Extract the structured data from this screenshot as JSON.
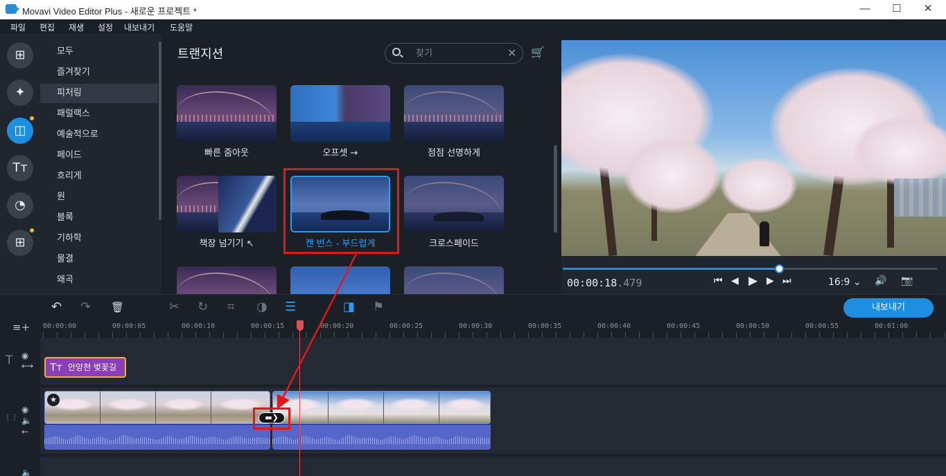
{
  "window": {
    "title": "Movavi Video Editor Plus - 새로운 프로젝트 *",
    "minimize": "—",
    "maximize": "☐",
    "close": "✕"
  },
  "menu": [
    "파일",
    "편집",
    "재생",
    "설정",
    "내보내기",
    "도움말"
  ],
  "icons": {
    "import": "⊞",
    "magic": "✦",
    "transitions": "◫",
    "titles": "Tт",
    "stickers": "◔",
    "more": "⊞"
  },
  "categories": [
    "모두",
    "즐겨찾기",
    "피처링",
    "패럴랙스",
    "예술적으로",
    "페이드",
    "흐리게",
    "원",
    "블록",
    "기하학",
    "물결",
    "왜곡"
  ],
  "active_category": "피처링",
  "panel": {
    "title": "트랜지션",
    "search_placeholder": "찾기",
    "clear": "✕",
    "cart": "🛒"
  },
  "tiles": [
    {
      "label": "빠른 줌아웃"
    },
    {
      "label": "오프셋 →"
    },
    {
      "label": "점점 선명하게"
    },
    {
      "label": "책장 넘기기 ↖"
    },
    {
      "label": "켄 번스 - 부드럽게",
      "selected": true
    },
    {
      "label": "크로스페이드"
    }
  ],
  "player": {
    "timecode_main": "00:00:18",
    "timecode_ms": ".479",
    "aspect": "16:9 ⌄",
    "progress": 0.58,
    "controls": {
      "prev": "⏮",
      "step_back": "◀",
      "play": "▶",
      "step_fwd": "▶",
      "next": "⏭",
      "volume": "🔊",
      "snapshot": "📷"
    }
  },
  "toolbar": {
    "undo": "↶",
    "redo": "↷",
    "delete": "🗑",
    "cut": "✂",
    "rotate": "↻",
    "crop": "⌗",
    "color": "◑",
    "adjust": "☰",
    "transition": "◨",
    "marker": "⚑",
    "export_label": "내보내기",
    "add_track": "≡+"
  },
  "ruler": [
    "00:00:00",
    "00:00:05",
    "00:00:10",
    "00:00:15",
    "00:00:20",
    "00:00:25",
    "00:00:30",
    "00:00:35",
    "00:00:40",
    "00:00:45",
    "00:00:50",
    "00:00:55",
    "00:01:00"
  ],
  "timeline": {
    "title_clip_label": "안양천 벚꽃길",
    "title_clip_icon": "Tт",
    "star": "★",
    "transition_marker": "▬❯",
    "track_icons": {
      "text": "T",
      "eye": "◉",
      "link": "⟷",
      "speaker": "🔈",
      "arrow": "←",
      "grip": "⋮⋮"
    }
  },
  "colors": {
    "accent": "#1e8fe0",
    "selected_blue": "#2a9df4",
    "annotation_red": "#e01818",
    "title_clip": "#8a3fb8",
    "background": "#1b2027"
  }
}
